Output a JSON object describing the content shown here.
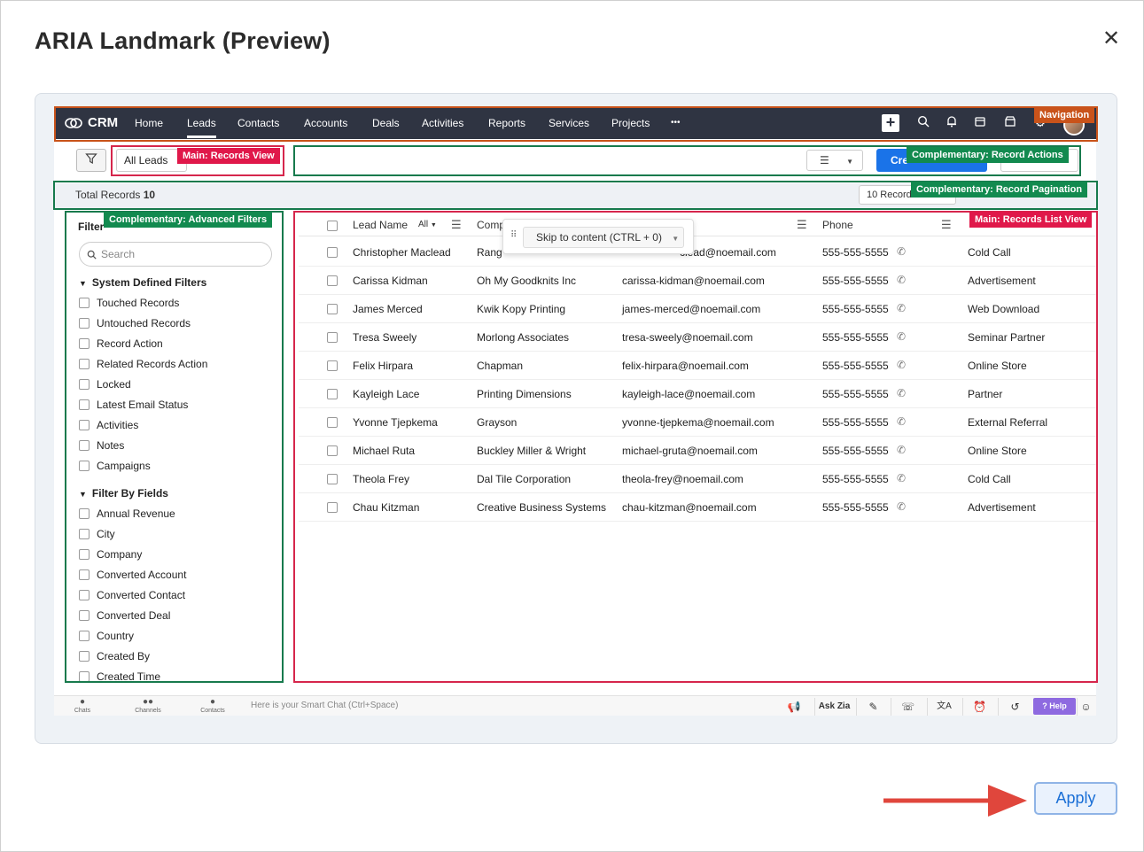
{
  "dialog": {
    "title": "ARIA Landmark (Preview)",
    "close": "✕",
    "apply_label": "Apply"
  },
  "crm": {
    "brand": "CRM",
    "nav": [
      "Home",
      "Leads",
      "Contacts",
      "Accounts",
      "Deals",
      "Activities",
      "Reports",
      "Services",
      "Projects",
      "•••"
    ],
    "active_nav": "Leads",
    "view_selector": "All Leads",
    "create_label": "Cre",
    "total_label": "Total Records",
    "total_value": "10",
    "per_page": "10 Record",
    "sidebar": {
      "title": "Filter",
      "search_placeholder": "Search",
      "system_group": "System Defined Filters",
      "system_filters": [
        "Touched Records",
        "Untouched Records",
        "Record Action",
        "Related Records Action",
        "Locked",
        "Latest Email Status",
        "Activities",
        "Notes",
        "Campaigns"
      ],
      "fields_group": "Filter By Fields",
      "field_filters": [
        "Annual Revenue",
        "City",
        "Company",
        "Converted Account",
        "Converted Contact",
        "Converted Deal",
        "Country",
        "Created By",
        "Created Time"
      ]
    },
    "table": {
      "headers": {
        "lead_name": "Lead Name",
        "all": "All",
        "company": "Comp",
        "phone": "Phone"
      },
      "rows": [
        {
          "name": "Christopher Maclead",
          "company": "Rang",
          "email": "clead@noemail.com",
          "phone": "555-555-5555",
          "source": "Cold Call"
        },
        {
          "name": "Carissa Kidman",
          "company": "Oh My Goodknits Inc",
          "email": "carissa-kidman@noemail.com",
          "phone": "555-555-5555",
          "source": "Advertisement"
        },
        {
          "name": "James Merced",
          "company": "Kwik Kopy Printing",
          "email": "james-merced@noemail.com",
          "phone": "555-555-5555",
          "source": "Web Download"
        },
        {
          "name": "Tresa Sweely",
          "company": "Morlong Associates",
          "email": "tresa-sweely@noemail.com",
          "phone": "555-555-5555",
          "source": "Seminar Partner"
        },
        {
          "name": "Felix Hirpara",
          "company": "Chapman",
          "email": "felix-hirpara@noemail.com",
          "phone": "555-555-5555",
          "source": "Online Store"
        },
        {
          "name": "Kayleigh Lace",
          "company": "Printing Dimensions",
          "email": "kayleigh-lace@noemail.com",
          "phone": "555-555-5555",
          "source": "Partner"
        },
        {
          "name": "Yvonne Tjepkema",
          "company": "Grayson",
          "email": "yvonne-tjepkema@noemail.com",
          "phone": "555-555-5555",
          "source": "External Referral"
        },
        {
          "name": "Michael Ruta",
          "company": "Buckley Miller & Wright",
          "email": "michael-gruta@noemail.com",
          "phone": "555-555-5555",
          "source": "Online Store"
        },
        {
          "name": "Theola Frey",
          "company": "Dal Tile Corporation",
          "email": "theola-frey@noemail.com",
          "phone": "555-555-5555",
          "source": "Cold Call"
        },
        {
          "name": "Chau Kitzman",
          "company": "Creative Business Systems",
          "email": "chau-kitzman@noemail.com",
          "phone": "555-555-5555",
          "source": "Advertisement"
        }
      ]
    },
    "skip_label": "Skip to content (CTRL + 0)",
    "bottom": {
      "chats": "Chats",
      "channels": "Channels",
      "contacts": "Contacts",
      "smart_chat": "Here is your Smart Chat (Ctrl+Space)",
      "ask_zia": "Ask Zia",
      "help": "Help"
    }
  },
  "landmarks": {
    "navigation": "Navigation",
    "records_view": "Main: Records View",
    "record_actions": "Complementary: Record Actions",
    "record_pagination": "Complementary: Record Pagination",
    "advanced_filters": "Complementary: Advanced Filters",
    "records_list": "Main: Records List View"
  },
  "colors": {
    "navigation": "#c9531a",
    "main": "#e0184a",
    "complementary": "#128a4f",
    "apply": "#1a6fd6",
    "arrow": "#e0463c"
  }
}
